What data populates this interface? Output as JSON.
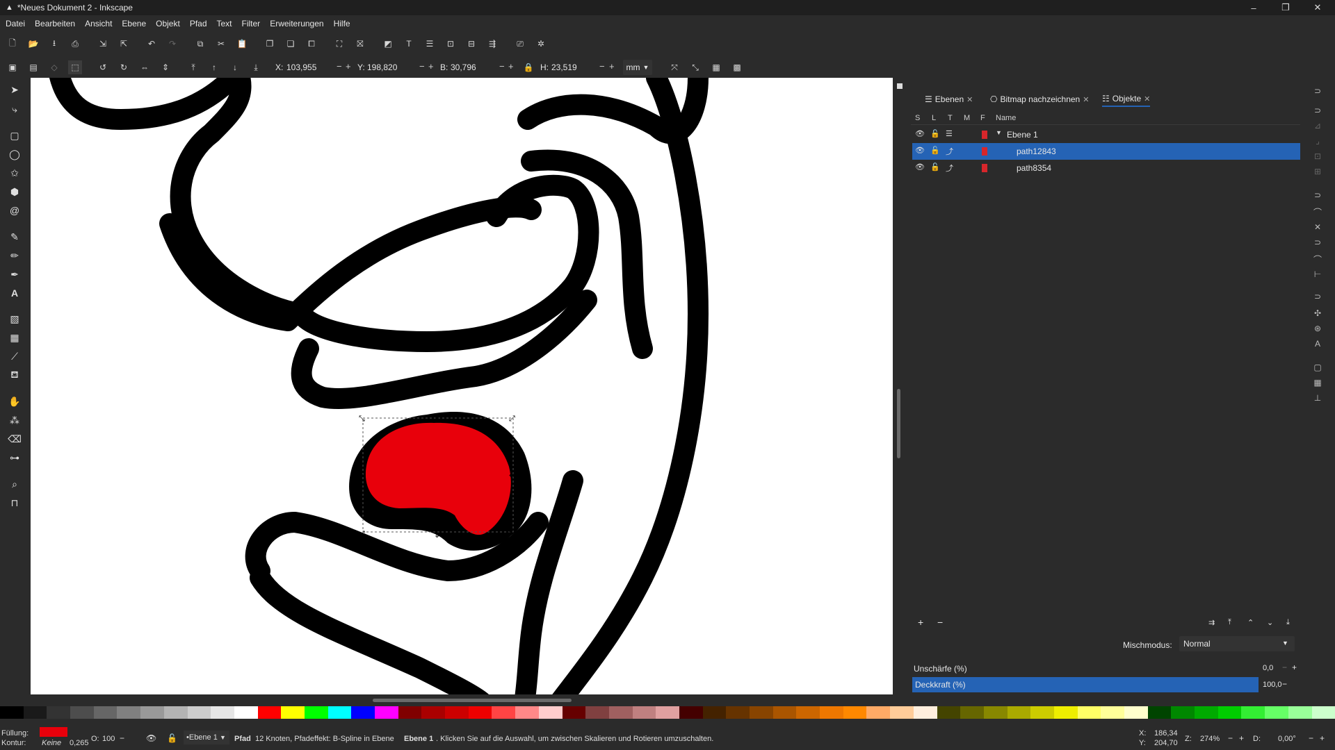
{
  "window": {
    "title": "*Neues Dokument 2 - Inkscape",
    "controls": [
      "–",
      "❐",
      "✕"
    ]
  },
  "menu": [
    "Datei",
    "Bearbeiten",
    "Ansicht",
    "Ebene",
    "Objekt",
    "Pfad",
    "Text",
    "Filter",
    "Erweiterungen",
    "Hilfe"
  ],
  "controls": {
    "x_label": "X:",
    "x_value": "103,955",
    "y_label": "Y:",
    "y_value": "198,820",
    "w_label": "B:",
    "w_value": "30,796",
    "h_label": "H:",
    "h_value": "23,519",
    "unit": "mm"
  },
  "panel": {
    "tabs": [
      {
        "label": "Ebenen",
        "icon": "layers-icon"
      },
      {
        "label": "Bitmap nachzeichnen",
        "icon": "trace-bitmap-icon"
      },
      {
        "label": "Objekte",
        "icon": "objects-icon"
      }
    ],
    "columns": [
      "S",
      "L",
      "T",
      "M",
      "F",
      "Name"
    ],
    "rows": [
      {
        "name": "Ebene 1",
        "selected": false,
        "color": "#d7262b"
      },
      {
        "name": "path12843",
        "selected": true,
        "color": "#d7262b"
      },
      {
        "name": "path8354",
        "selected": false,
        "color": "#d7262b"
      }
    ],
    "blend_label": "Mischmodus:",
    "blend_value": "Normal",
    "blur_label": "Unschärfe (%)",
    "blur_value": "0,0",
    "opacity_label": "Deckkraft (%)",
    "opacity_value": "100,0",
    "opacity_fraction": 1.0
  },
  "status": {
    "fill_label": "Füllung:",
    "stroke_label": "Kontur:",
    "stroke_value": "Keine",
    "stroke_width": "0,265",
    "opacity_label": "O:",
    "opacity_value": "100",
    "layer": "•Ebene 1",
    "message_bold": "Pfad",
    "message": "12 Knoten, Pfadeffekt: B-Spline in Ebene",
    "message_layer": "Ebene 1",
    "message_tail": ". Klicken Sie auf die Auswahl, um zwischen Skalieren und Rotieren umzuschalten.",
    "cursor_x_label": "X:",
    "cursor_x": "186,34",
    "cursor_y_label": "Y:",
    "cursor_y": "204,70",
    "zoom_label": "Z:",
    "zoom": "274%",
    "rotation_label": "D:",
    "rotation": "0,00°"
  },
  "colors": {
    "fill": "#e8000b",
    "accent": "#2563b5"
  }
}
